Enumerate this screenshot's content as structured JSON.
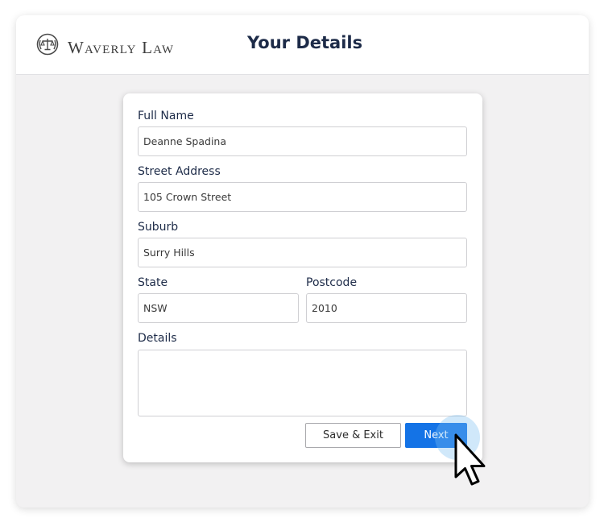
{
  "header": {
    "brand": "Waverly Law",
    "logo_icon": "scales-of-justice-icon",
    "title": "Your Details"
  },
  "form": {
    "full_name": {
      "label": "Full Name",
      "value": "Deanne Spadina"
    },
    "street_address": {
      "label": "Street Address",
      "value": "105 Crown Street"
    },
    "suburb": {
      "label": "Suburb",
      "value": "Surry Hills"
    },
    "state": {
      "label": "State",
      "value": "NSW"
    },
    "postcode": {
      "label": "Postcode",
      "value": "2010"
    },
    "details": {
      "label": "Details",
      "value": ""
    }
  },
  "actions": {
    "save_exit": "Save & Exit",
    "next": "Next"
  },
  "colors": {
    "primary": "#1473e6",
    "heading": "#1d2b48",
    "background": "#f2f1f2"
  }
}
